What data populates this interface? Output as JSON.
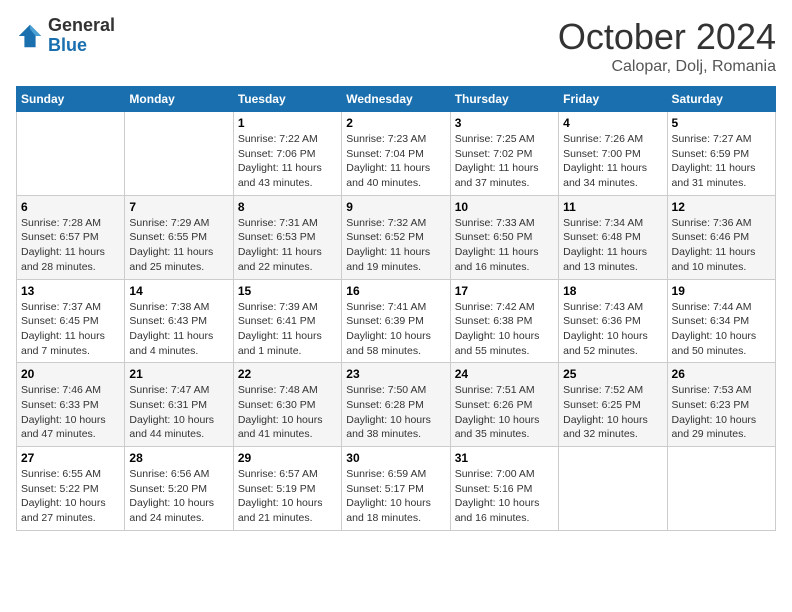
{
  "header": {
    "logo_general": "General",
    "logo_blue": "Blue",
    "month_title": "October 2024",
    "location": "Calopar, Dolj, Romania"
  },
  "weekdays": [
    "Sunday",
    "Monday",
    "Tuesday",
    "Wednesday",
    "Thursday",
    "Friday",
    "Saturday"
  ],
  "weeks": [
    [
      {
        "day": "",
        "info": ""
      },
      {
        "day": "",
        "info": ""
      },
      {
        "day": "1",
        "info": "Sunrise: 7:22 AM\nSunset: 7:06 PM\nDaylight: 11 hours and 43 minutes."
      },
      {
        "day": "2",
        "info": "Sunrise: 7:23 AM\nSunset: 7:04 PM\nDaylight: 11 hours and 40 minutes."
      },
      {
        "day": "3",
        "info": "Sunrise: 7:25 AM\nSunset: 7:02 PM\nDaylight: 11 hours and 37 minutes."
      },
      {
        "day": "4",
        "info": "Sunrise: 7:26 AM\nSunset: 7:00 PM\nDaylight: 11 hours and 34 minutes."
      },
      {
        "day": "5",
        "info": "Sunrise: 7:27 AM\nSunset: 6:59 PM\nDaylight: 11 hours and 31 minutes."
      }
    ],
    [
      {
        "day": "6",
        "info": "Sunrise: 7:28 AM\nSunset: 6:57 PM\nDaylight: 11 hours and 28 minutes."
      },
      {
        "day": "7",
        "info": "Sunrise: 7:29 AM\nSunset: 6:55 PM\nDaylight: 11 hours and 25 minutes."
      },
      {
        "day": "8",
        "info": "Sunrise: 7:31 AM\nSunset: 6:53 PM\nDaylight: 11 hours and 22 minutes."
      },
      {
        "day": "9",
        "info": "Sunrise: 7:32 AM\nSunset: 6:52 PM\nDaylight: 11 hours and 19 minutes."
      },
      {
        "day": "10",
        "info": "Sunrise: 7:33 AM\nSunset: 6:50 PM\nDaylight: 11 hours and 16 minutes."
      },
      {
        "day": "11",
        "info": "Sunrise: 7:34 AM\nSunset: 6:48 PM\nDaylight: 11 hours and 13 minutes."
      },
      {
        "day": "12",
        "info": "Sunrise: 7:36 AM\nSunset: 6:46 PM\nDaylight: 11 hours and 10 minutes."
      }
    ],
    [
      {
        "day": "13",
        "info": "Sunrise: 7:37 AM\nSunset: 6:45 PM\nDaylight: 11 hours and 7 minutes."
      },
      {
        "day": "14",
        "info": "Sunrise: 7:38 AM\nSunset: 6:43 PM\nDaylight: 11 hours and 4 minutes."
      },
      {
        "day": "15",
        "info": "Sunrise: 7:39 AM\nSunset: 6:41 PM\nDaylight: 11 hours and 1 minute."
      },
      {
        "day": "16",
        "info": "Sunrise: 7:41 AM\nSunset: 6:39 PM\nDaylight: 10 hours and 58 minutes."
      },
      {
        "day": "17",
        "info": "Sunrise: 7:42 AM\nSunset: 6:38 PM\nDaylight: 10 hours and 55 minutes."
      },
      {
        "day": "18",
        "info": "Sunrise: 7:43 AM\nSunset: 6:36 PM\nDaylight: 10 hours and 52 minutes."
      },
      {
        "day": "19",
        "info": "Sunrise: 7:44 AM\nSunset: 6:34 PM\nDaylight: 10 hours and 50 minutes."
      }
    ],
    [
      {
        "day": "20",
        "info": "Sunrise: 7:46 AM\nSunset: 6:33 PM\nDaylight: 10 hours and 47 minutes."
      },
      {
        "day": "21",
        "info": "Sunrise: 7:47 AM\nSunset: 6:31 PM\nDaylight: 10 hours and 44 minutes."
      },
      {
        "day": "22",
        "info": "Sunrise: 7:48 AM\nSunset: 6:30 PM\nDaylight: 10 hours and 41 minutes."
      },
      {
        "day": "23",
        "info": "Sunrise: 7:50 AM\nSunset: 6:28 PM\nDaylight: 10 hours and 38 minutes."
      },
      {
        "day": "24",
        "info": "Sunrise: 7:51 AM\nSunset: 6:26 PM\nDaylight: 10 hours and 35 minutes."
      },
      {
        "day": "25",
        "info": "Sunrise: 7:52 AM\nSunset: 6:25 PM\nDaylight: 10 hours and 32 minutes."
      },
      {
        "day": "26",
        "info": "Sunrise: 7:53 AM\nSunset: 6:23 PM\nDaylight: 10 hours and 29 minutes."
      }
    ],
    [
      {
        "day": "27",
        "info": "Sunrise: 6:55 AM\nSunset: 5:22 PM\nDaylight: 10 hours and 27 minutes."
      },
      {
        "day": "28",
        "info": "Sunrise: 6:56 AM\nSunset: 5:20 PM\nDaylight: 10 hours and 24 minutes."
      },
      {
        "day": "29",
        "info": "Sunrise: 6:57 AM\nSunset: 5:19 PM\nDaylight: 10 hours and 21 minutes."
      },
      {
        "day": "30",
        "info": "Sunrise: 6:59 AM\nSunset: 5:17 PM\nDaylight: 10 hours and 18 minutes."
      },
      {
        "day": "31",
        "info": "Sunrise: 7:00 AM\nSunset: 5:16 PM\nDaylight: 10 hours and 16 minutes."
      },
      {
        "day": "",
        "info": ""
      },
      {
        "day": "",
        "info": ""
      }
    ]
  ]
}
